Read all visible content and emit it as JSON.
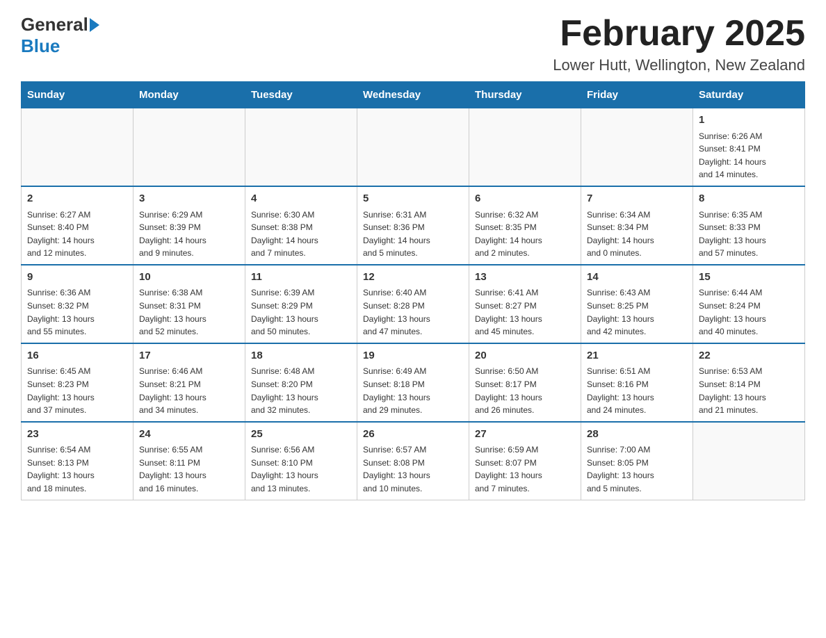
{
  "logo": {
    "general": "General",
    "blue": "Blue"
  },
  "title": "February 2025",
  "location": "Lower Hutt, Wellington, New Zealand",
  "weekdays": [
    "Sunday",
    "Monday",
    "Tuesday",
    "Wednesday",
    "Thursday",
    "Friday",
    "Saturday"
  ],
  "weeks": [
    [
      {
        "day": "",
        "info": ""
      },
      {
        "day": "",
        "info": ""
      },
      {
        "day": "",
        "info": ""
      },
      {
        "day": "",
        "info": ""
      },
      {
        "day": "",
        "info": ""
      },
      {
        "day": "",
        "info": ""
      },
      {
        "day": "1",
        "info": "Sunrise: 6:26 AM\nSunset: 8:41 PM\nDaylight: 14 hours\nand 14 minutes."
      }
    ],
    [
      {
        "day": "2",
        "info": "Sunrise: 6:27 AM\nSunset: 8:40 PM\nDaylight: 14 hours\nand 12 minutes."
      },
      {
        "day": "3",
        "info": "Sunrise: 6:29 AM\nSunset: 8:39 PM\nDaylight: 14 hours\nand 9 minutes."
      },
      {
        "day": "4",
        "info": "Sunrise: 6:30 AM\nSunset: 8:38 PM\nDaylight: 14 hours\nand 7 minutes."
      },
      {
        "day": "5",
        "info": "Sunrise: 6:31 AM\nSunset: 8:36 PM\nDaylight: 14 hours\nand 5 minutes."
      },
      {
        "day": "6",
        "info": "Sunrise: 6:32 AM\nSunset: 8:35 PM\nDaylight: 14 hours\nand 2 minutes."
      },
      {
        "day": "7",
        "info": "Sunrise: 6:34 AM\nSunset: 8:34 PM\nDaylight: 14 hours\nand 0 minutes."
      },
      {
        "day": "8",
        "info": "Sunrise: 6:35 AM\nSunset: 8:33 PM\nDaylight: 13 hours\nand 57 minutes."
      }
    ],
    [
      {
        "day": "9",
        "info": "Sunrise: 6:36 AM\nSunset: 8:32 PM\nDaylight: 13 hours\nand 55 minutes."
      },
      {
        "day": "10",
        "info": "Sunrise: 6:38 AM\nSunset: 8:31 PM\nDaylight: 13 hours\nand 52 minutes."
      },
      {
        "day": "11",
        "info": "Sunrise: 6:39 AM\nSunset: 8:29 PM\nDaylight: 13 hours\nand 50 minutes."
      },
      {
        "day": "12",
        "info": "Sunrise: 6:40 AM\nSunset: 8:28 PM\nDaylight: 13 hours\nand 47 minutes."
      },
      {
        "day": "13",
        "info": "Sunrise: 6:41 AM\nSunset: 8:27 PM\nDaylight: 13 hours\nand 45 minutes."
      },
      {
        "day": "14",
        "info": "Sunrise: 6:43 AM\nSunset: 8:25 PM\nDaylight: 13 hours\nand 42 minutes."
      },
      {
        "day": "15",
        "info": "Sunrise: 6:44 AM\nSunset: 8:24 PM\nDaylight: 13 hours\nand 40 minutes."
      }
    ],
    [
      {
        "day": "16",
        "info": "Sunrise: 6:45 AM\nSunset: 8:23 PM\nDaylight: 13 hours\nand 37 minutes."
      },
      {
        "day": "17",
        "info": "Sunrise: 6:46 AM\nSunset: 8:21 PM\nDaylight: 13 hours\nand 34 minutes."
      },
      {
        "day": "18",
        "info": "Sunrise: 6:48 AM\nSunset: 8:20 PM\nDaylight: 13 hours\nand 32 minutes."
      },
      {
        "day": "19",
        "info": "Sunrise: 6:49 AM\nSunset: 8:18 PM\nDaylight: 13 hours\nand 29 minutes."
      },
      {
        "day": "20",
        "info": "Sunrise: 6:50 AM\nSunset: 8:17 PM\nDaylight: 13 hours\nand 26 minutes."
      },
      {
        "day": "21",
        "info": "Sunrise: 6:51 AM\nSunset: 8:16 PM\nDaylight: 13 hours\nand 24 minutes."
      },
      {
        "day": "22",
        "info": "Sunrise: 6:53 AM\nSunset: 8:14 PM\nDaylight: 13 hours\nand 21 minutes."
      }
    ],
    [
      {
        "day": "23",
        "info": "Sunrise: 6:54 AM\nSunset: 8:13 PM\nDaylight: 13 hours\nand 18 minutes."
      },
      {
        "day": "24",
        "info": "Sunrise: 6:55 AM\nSunset: 8:11 PM\nDaylight: 13 hours\nand 16 minutes."
      },
      {
        "day": "25",
        "info": "Sunrise: 6:56 AM\nSunset: 8:10 PM\nDaylight: 13 hours\nand 13 minutes."
      },
      {
        "day": "26",
        "info": "Sunrise: 6:57 AM\nSunset: 8:08 PM\nDaylight: 13 hours\nand 10 minutes."
      },
      {
        "day": "27",
        "info": "Sunrise: 6:59 AM\nSunset: 8:07 PM\nDaylight: 13 hours\nand 7 minutes."
      },
      {
        "day": "28",
        "info": "Sunrise: 7:00 AM\nSunset: 8:05 PM\nDaylight: 13 hours\nand 5 minutes."
      },
      {
        "day": "",
        "info": ""
      }
    ]
  ]
}
